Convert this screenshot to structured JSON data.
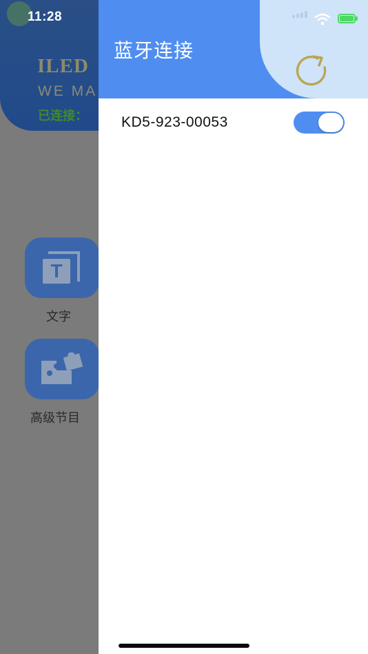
{
  "status_bar": {
    "time": "11:28"
  },
  "background_app": {
    "logo": "ILED",
    "slogan": "WE MA",
    "connection_status": "已连接：",
    "functions": [
      {
        "label": "文字",
        "icon": "text-t-icon"
      },
      {
        "label": "高级节目",
        "icon": "puzzle-icon"
      }
    ]
  },
  "drawer": {
    "title": "蓝牙连接",
    "refresh_icon": "refresh-icon",
    "devices": [
      {
        "name": "KD5-923-00053",
        "connected": true
      }
    ]
  },
  "colors": {
    "accent": "#4f8ef0",
    "header_light": "#cfe3f9",
    "refresh_icon": "#b9a651",
    "connected_text": "#3f8a2e"
  }
}
